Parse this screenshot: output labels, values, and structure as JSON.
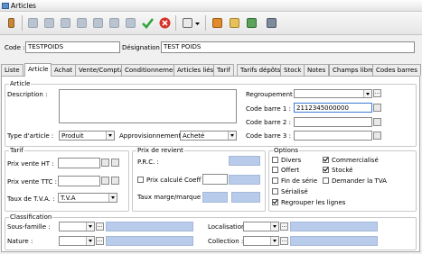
{
  "window": {
    "title": "Articles"
  },
  "header": {
    "code_label": "Code :",
    "code_value": "TESTPOIDS",
    "designation_label": "Désignation :",
    "designation_value": "TEST POIDS"
  },
  "tabs": [
    "Liste",
    "Article",
    "Achat",
    "Vente/Compta",
    "Conditionnement",
    "Articles liés",
    "Tarif",
    "Tarifs dépôts",
    "Stock",
    "Notes",
    "Champs libres",
    "Codes barres"
  ],
  "article": {
    "group_label": "Article",
    "description_label": "Description :",
    "regroupement_label": "Regroupement :",
    "code_barre_1_label": "Code barre 1 :",
    "code_barre_1_value": "2112345000000",
    "code_barre_2_label": "Code barre 2 :",
    "code_barre_3_label": "Code barre 3 :",
    "type_label": "Type d'article :",
    "type_value": "Produit",
    "appro_label": "Approvisionnement :",
    "appro_value": "Acheté"
  },
  "tarif": {
    "group_label": "Tarif",
    "pv_ht_label": "Prix vente HT :",
    "pv_ttc_label": "Prix vente TTC :",
    "tva_label": "Taux de T.V.A. :",
    "tva_value": "T.V.A"
  },
  "prix_revient": {
    "group_label": "Prix de revient",
    "prc_label": "P.R.C. :",
    "prix_calcule_label": "Prix calculé",
    "coeff_label": "Coeff :",
    "taux_marge_label": "Taux marge/marque :"
  },
  "options": {
    "group_label": "Options",
    "items": [
      {
        "label": "Divers",
        "checked": false
      },
      {
        "label": "Commercialisé",
        "checked": true
      },
      {
        "label": "Offert",
        "checked": false
      },
      {
        "label": "Stocké",
        "checked": true
      },
      {
        "label": "Fin de série",
        "checked": false
      },
      {
        "label": "Demander la TVA",
        "checked": false
      },
      {
        "label": "Sérialisé",
        "checked": false
      },
      {
        "label": "Regrouper les lignes",
        "checked": true
      }
    ]
  },
  "classification": {
    "group_label": "Classification",
    "sous_famille_label": "Sous-famille :",
    "nature_label": "Nature :",
    "localisation_label": "Localisation :",
    "collection_label": "Collection :"
  },
  "colors": {
    "accent_blue": "#b9cbea",
    "active_field_border": "#3b7bd6",
    "save_green": "#2ea43a",
    "cancel_red": "#d8322a"
  }
}
